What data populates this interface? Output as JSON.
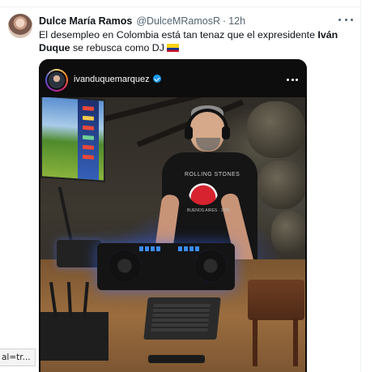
{
  "tweet": {
    "author_name": "Dulce María Ramos",
    "author_handle": "@DulceMRamosR",
    "separator": "·",
    "timestamp": "12h",
    "text_before": "El desempleo en Colombia está tan tenaz que el expresidente ",
    "text_bold": "Iván Duque",
    "text_after": " se rebusca como DJ",
    "flag_icon": "colombia-flag-emoji",
    "more_icon": "more-horizontal-icon"
  },
  "embedded_post": {
    "username": "ivanduquemarquez",
    "verified_icon": "verified-badge-icon",
    "more_icon": "more-horizontal-icon",
    "shirt_text": "ROLLING STONES",
    "shirt_subtext": "BUENOS AIRES · 1995"
  },
  "status_bar": {
    "url_fragment": "al=tr..."
  },
  "colors": {
    "accent": "#1d9bf0",
    "text_primary": "#0f1419",
    "text_secondary": "#536471"
  }
}
